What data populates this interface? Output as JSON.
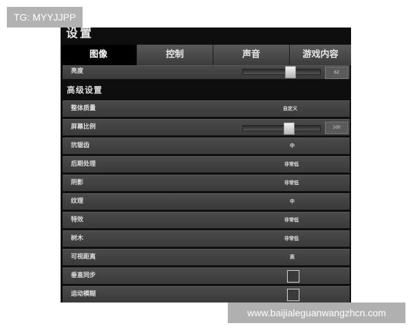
{
  "watermarks": {
    "top_left": "TG: MYYJJPP",
    "bottom_right": "www.baijialeguanwangzhcn.com"
  },
  "window": {
    "title": "设置"
  },
  "tabs": [
    {
      "label": "图像",
      "active": true
    },
    {
      "label": "控制",
      "active": false
    },
    {
      "label": "声音",
      "active": false
    },
    {
      "label": "游戏内容",
      "active": false
    }
  ],
  "brightness": {
    "label": "亮度",
    "value": "62",
    "level": 0.62
  },
  "advanced": {
    "title": "高级设置",
    "overall_quality": {
      "label": "整体质量",
      "value": "自定义"
    },
    "screen_ratio": {
      "label": "屏幕比例",
      "value": "100",
      "level": 0.6
    },
    "anti_aliasing": {
      "label": "抗锯齿",
      "value": "中"
    },
    "post_processing": {
      "label": "后期处理",
      "value": "非常低"
    },
    "shadows": {
      "label": "阴影",
      "value": "非常低"
    },
    "textures": {
      "label": "纹理",
      "value": "中"
    },
    "effects": {
      "label": "特效",
      "value": "非常低"
    },
    "trees": {
      "label": "树木",
      "value": "非常低"
    },
    "view_distance": {
      "label": "可视距离",
      "value": "高"
    },
    "vsync": {
      "label": "垂直同步",
      "checked": false
    },
    "motion_blur": {
      "label": "运动模糊",
      "checked": false
    }
  },
  "colors": {
    "panel_bg": "#0e0e0e",
    "row_bg": "#444444",
    "active_tab": "#000000",
    "text": "#dcdcdc"
  }
}
